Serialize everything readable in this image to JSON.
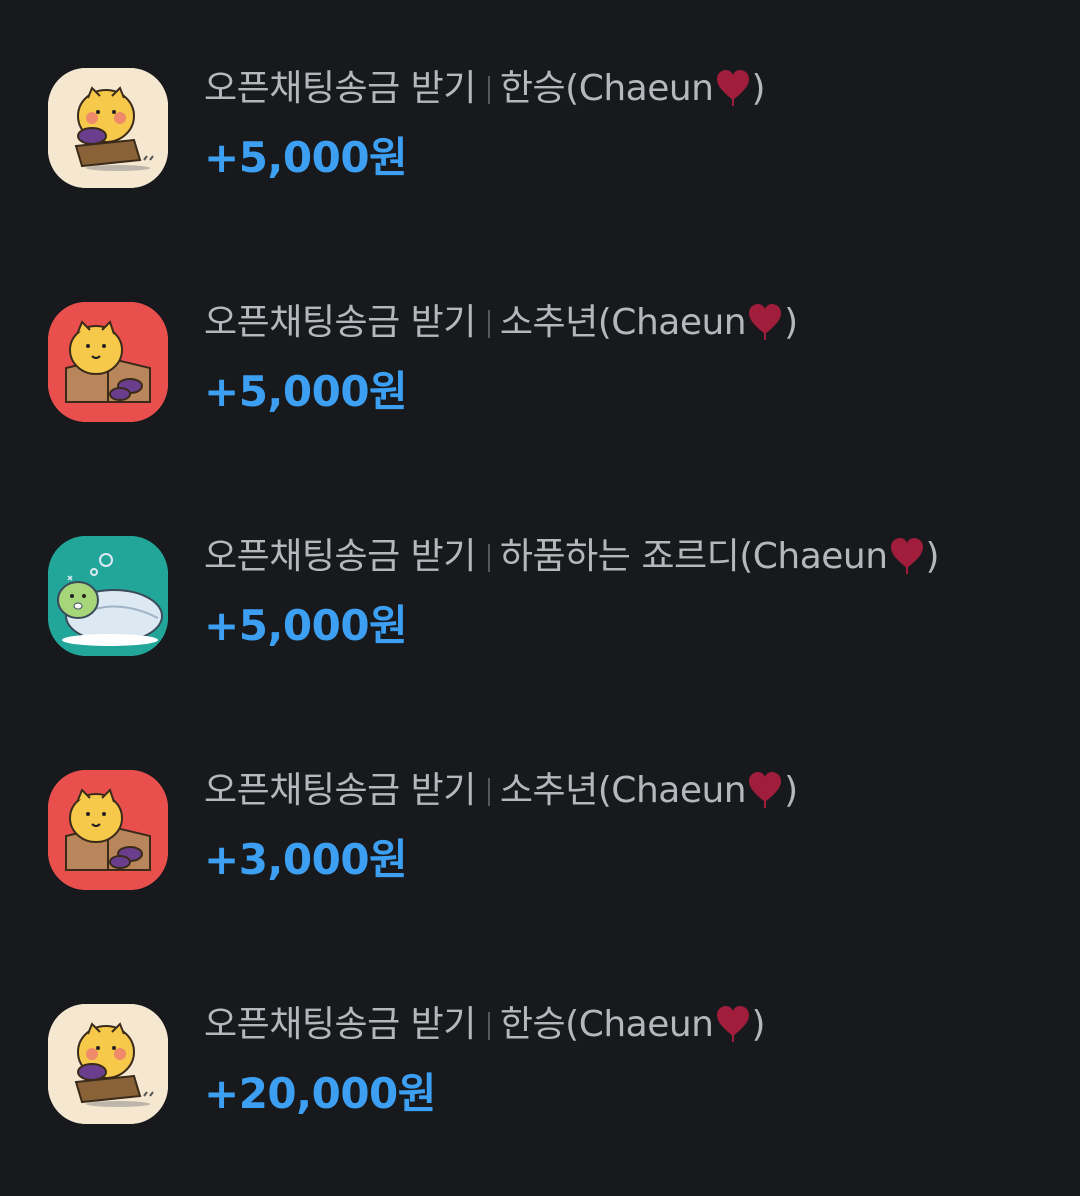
{
  "transactions": [
    {
      "kind": "오픈채팅송금 받기",
      "sender_name": "한승(Chaeun",
      "sender_close": ")",
      "amount": "+5,000원",
      "avatar_icon": "cat-eating-sweet-potato-icon",
      "avatar_bg": "#f6e7d0"
    },
    {
      "kind": "오픈채팅송금 받기",
      "sender_name": "소추년(Chaeun",
      "sender_close": ")",
      "amount": "+5,000원",
      "avatar_icon": "cat-in-box-icon",
      "avatar_bg": "#e9504d"
    },
    {
      "kind": "오픈채팅송금 받기",
      "sender_name": "하품하는 죠르디(Chaeun",
      "sender_close": ")",
      "amount": "+5,000원",
      "avatar_icon": "sleeping-jordy-icon",
      "avatar_bg": "#23a69a"
    },
    {
      "kind": "오픈채팅송금 받기",
      "sender_name": "소추년(Chaeun",
      "sender_close": ")",
      "amount": "+3,000원",
      "avatar_icon": "cat-in-box-icon",
      "avatar_bg": "#e9504d"
    },
    {
      "kind": "오픈채팅송금 받기",
      "sender_name": "한승(Chaeun",
      "sender_close": ")",
      "amount": "+20,000원",
      "avatar_icon": "cat-eating-sweet-potato-icon",
      "avatar_bg": "#f6e7d0"
    }
  ],
  "colors": {
    "background": "#17191c",
    "title_text": "#b4b8bc",
    "amount_text": "#3d9ff2",
    "heart": "#a11d3c"
  }
}
